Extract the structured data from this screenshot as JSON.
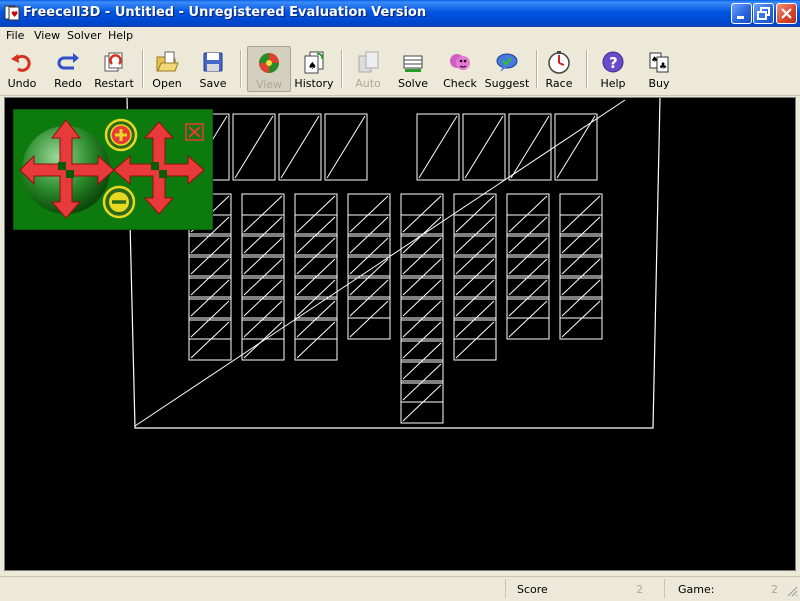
{
  "window": {
    "title": "Freecell3D - Untitled - Unregistered Evaluation Version",
    "controls": [
      "minimize",
      "maximize",
      "close"
    ]
  },
  "menu": {
    "items": [
      "File",
      "View",
      "Solver",
      "Help"
    ]
  },
  "toolbar": {
    "buttons": [
      {
        "label": "Undo",
        "icon": "undo-icon",
        "enabled": true
      },
      {
        "label": "Redo",
        "icon": "redo-icon",
        "enabled": true
      },
      {
        "label": "Restart",
        "icon": "restart-icon",
        "enabled": true
      },
      {
        "label": "Open",
        "icon": "open-icon",
        "enabled": true
      },
      {
        "label": "Save",
        "icon": "save-icon",
        "enabled": true
      },
      {
        "label": "View",
        "icon": "view-icon",
        "enabled": false,
        "pressed": true
      },
      {
        "label": "History",
        "icon": "history-icon",
        "enabled": true
      },
      {
        "label": "Auto",
        "icon": "auto-icon",
        "enabled": false
      },
      {
        "label": "Solve",
        "icon": "solve-icon",
        "enabled": true
      },
      {
        "label": "Check",
        "icon": "check-icon",
        "enabled": true
      },
      {
        "label": "Suggest",
        "icon": "suggest-icon",
        "enabled": true
      },
      {
        "label": "Race",
        "icon": "race-icon",
        "enabled": true
      },
      {
        "label": "Help",
        "icon": "help-icon",
        "enabled": true
      },
      {
        "label": "Buy",
        "icon": "buy-icon",
        "enabled": true
      }
    ]
  },
  "board": {
    "freecells": 4,
    "foundations": 4,
    "tableau_card_counts": [
      7,
      7,
      7,
      6,
      10,
      7,
      6,
      6
    ],
    "render_mode": "wireframe"
  },
  "nav_overlay": {
    "icons": [
      "rotate-arrows-icon",
      "zoom-in-icon",
      "pan-arrows-icon",
      "zoom-out-icon",
      "close-overlay-icon"
    ]
  },
  "status": {
    "score_label": "Score",
    "score_value": "2",
    "game_label": "Game:",
    "game_value": "2"
  },
  "colors": {
    "titlebar": "#0054e3",
    "board_background": "#000000",
    "wireframe": "#ffffff",
    "overlay_green": "#0d7a0d",
    "arrow_red": "#e83a3a",
    "overlay_yellow": "#e8d820"
  }
}
